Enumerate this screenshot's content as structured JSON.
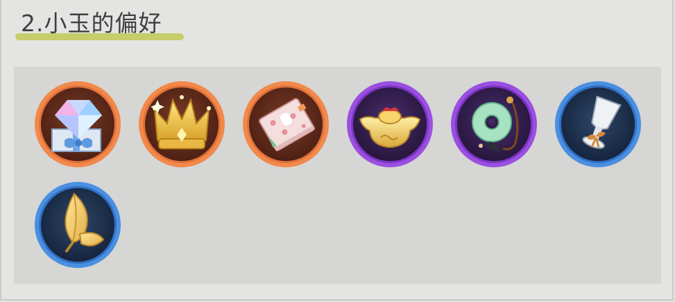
{
  "section": {
    "title": "2.小玉的偏好"
  },
  "colors": {
    "underline": "#c7cd6a",
    "panel": "#d6d6d5",
    "orange_rarity_ring": "#f2894a",
    "purple_rarity_ring": "#9a4fe0",
    "blue_rarity_ring": "#4a8fe0"
  },
  "items": [
    {
      "name": "diamond-gift-icon",
      "rarity": "orange"
    },
    {
      "name": "golden-crown-icon",
      "rarity": "orange"
    },
    {
      "name": "gift-book-icon",
      "rarity": "orange"
    },
    {
      "name": "gold-ingot-icon",
      "rarity": "purple"
    },
    {
      "name": "jade-pendant-icon",
      "rarity": "purple"
    },
    {
      "name": "silver-goblet-icon",
      "rarity": "blue"
    },
    {
      "name": "golden-leaf-icon",
      "rarity": "blue"
    }
  ]
}
